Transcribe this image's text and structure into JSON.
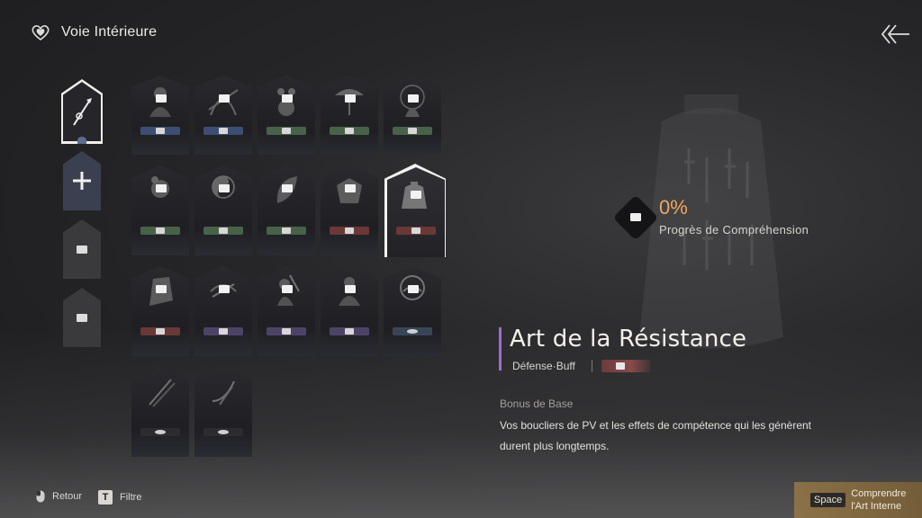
{
  "header": {
    "title": "Voie Intérieure"
  },
  "progress": {
    "value": "0%",
    "label": "Progrès de Compréhension"
  },
  "skill": {
    "name": "Art de la Résistance",
    "type": "Défense·Buff",
    "bonus_title": "Bonus de Base",
    "bonus_text": "Vos boucliers de PV et les effets de compétence qui les génèrent durent plus longtemps."
  },
  "footer": {
    "back_label": "Retour",
    "filter_key": "T",
    "filter_label": "Filtre",
    "action_key": "Space",
    "action_label_1": "Comprendre",
    "action_label_2": "l'Art Interne"
  },
  "colors": {
    "accent_purple": "#9d6fc9",
    "progress_orange": "#f0a85e"
  }
}
